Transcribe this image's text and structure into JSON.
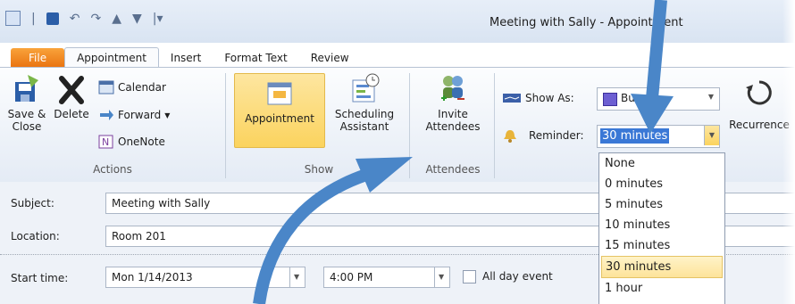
{
  "window": {
    "title": "Meeting with Sally - Appointment"
  },
  "tabs": [
    {
      "label": "File"
    },
    {
      "label": "Appointment"
    },
    {
      "label": "Insert"
    },
    {
      "label": "Format Text"
    },
    {
      "label": "Review"
    }
  ],
  "ribbon": {
    "actions": {
      "save_close": "Save &\nClose",
      "delete": "Delete",
      "calendar": "Calendar",
      "forward": "Forward",
      "onenote": "OneNote",
      "group_label": "Actions"
    },
    "show": {
      "appointment": "Appointment",
      "scheduling": "Scheduling\nAssistant",
      "group_label": "Show"
    },
    "attendees": {
      "invite": "Invite\nAttendees",
      "group_label": "Attendees"
    },
    "options": {
      "show_as_label": "Show As:",
      "show_as_value": "Bu",
      "reminder_label": "Reminder:",
      "reminder_value": "30 minutes",
      "recurrence": "Recurrence"
    }
  },
  "form": {
    "subject_label": "Subject:",
    "subject_value": "Meeting with Sally",
    "location_label": "Location:",
    "location_value": "Room 201",
    "start_label": "Start time:",
    "start_date": "Mon 1/14/2013",
    "start_time": "4:00 PM",
    "all_day_label": "All day event"
  },
  "reminder_options": [
    "None",
    "0 minutes",
    "5 minutes",
    "10 minutes",
    "15 minutes",
    "30 minutes",
    "1 hour"
  ],
  "reminder_selected_index": 5,
  "colors": {
    "accent": "#4a86c8",
    "file_tab": "#e9720f",
    "selection": "#fde39a",
    "arrow": "#4a86c8"
  }
}
